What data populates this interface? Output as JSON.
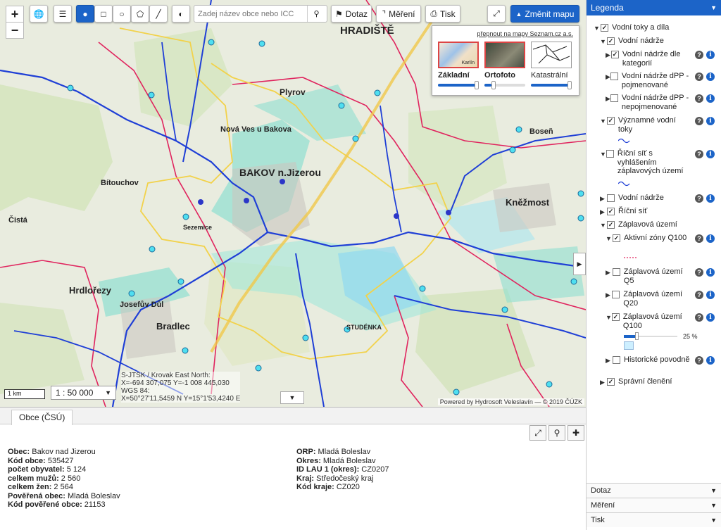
{
  "toolbar": {
    "zoom_in": "+",
    "zoom_out": "−",
    "search_placeholder": "Zadej název obce nebo ICC",
    "dotaz_label": "Dotaz",
    "mereni_label": "Měření",
    "tisk_label": "Tisk",
    "zmenit_mapu_label": "Změnit mapu"
  },
  "map_switcher": {
    "link": "přepnout na mapy Seznam.cz a.s.",
    "maps": [
      {
        "label": "Základní"
      },
      {
        "label": "Ortofoto"
      },
      {
        "label": "Katastrální"
      }
    ],
    "tile_text": "Karlín"
  },
  "map": {
    "labels": [
      {
        "text": "HRADIŠTĚ"
      },
      {
        "text": "BAKOV n.Jizerou"
      },
      {
        "text": "Kněžmost"
      },
      {
        "text": "Hrdlořezy"
      },
      {
        "text": "Bradlec"
      },
      {
        "text": "Plyrov"
      },
      {
        "text": "Nová Ves u Bakova"
      },
      {
        "text": "Bítouchov"
      },
      {
        "text": "Čistá"
      },
      {
        "text": "Josefův Důl"
      },
      {
        "text": "STUDÉNKA"
      },
      {
        "text": "Boseň"
      },
      {
        "text": "Sezemice"
      }
    ],
    "scale": "1 : 50 000",
    "scalebar": "1 km",
    "coords": [
      "S-JTSK / Krovak East North:",
      "X=-694 307,075 Y=-1 008 445,030",
      "WGS 84:",
      "X=50°27'11,5459 N Y=15°1'53,4240 E"
    ],
    "attribution": "Powered by Hydrosoft Veleslavín — © 2019 ČÚZK"
  },
  "bottom_panel": {
    "tab": "Obce (ČSÚ)",
    "left": [
      {
        "k": "Obec:",
        "v": " Bakov nad Jizerou"
      },
      {
        "k": "Kód obce:",
        "v": " 535427"
      },
      {
        "k": "počet obyvatel:",
        "v": " 5 124"
      },
      {
        "k": "celkem mužů:",
        "v": " 2 560"
      },
      {
        "k": "celkem žen:",
        "v": " 2 564"
      },
      {
        "k": "Pověřená obec:",
        "v": " Mladá Boleslav"
      },
      {
        "k": "Kód pověřené obce:",
        "v": " 21153"
      }
    ],
    "right": [
      {
        "k": "ORP:",
        "v": " Mladá Boleslav"
      },
      {
        "k": "Okres:",
        "v": " Mladá Boleslav"
      },
      {
        "k": "ID LAU 1 (okres):",
        "v": " CZ0207"
      },
      {
        "k": "Kraj:",
        "v": " Středočeský kraj"
      },
      {
        "k": "Kód kraje:",
        "v": " CZ020"
      }
    ]
  },
  "legend": {
    "title": "Legenda",
    "items": [
      {
        "label": "Vodní toky a díla"
      },
      {
        "label": "Vodní nádrže"
      },
      {
        "label": "Vodní nádrže dle kategorií"
      },
      {
        "label": "Vodní nádrže dPP - pojmenované"
      },
      {
        "label": "Vodní nádrže dPP - nepojmenované"
      },
      {
        "label": "Významné vodní toky"
      },
      {
        "label": "Říční síť s vyhlášením záplavových území"
      },
      {
        "label": "Vodní nádrže"
      },
      {
        "label": "Říční síť"
      },
      {
        "label": "Záplavová území"
      },
      {
        "label": "Aktivní zóny Q100"
      },
      {
        "label": "Záplavová území Q5"
      },
      {
        "label": "Záplavová území Q20"
      },
      {
        "label": "Záplavová území Q100"
      },
      {
        "label": "Historické povodně"
      },
      {
        "label": "Správní členění"
      }
    ],
    "opacity": "25 %",
    "opacity_value": 25,
    "accordions": [
      {
        "label": "Dotaz"
      },
      {
        "label": "Měření"
      },
      {
        "label": "Tisk"
      }
    ]
  },
  "colors": {
    "accent": "#1c64c8",
    "river": "#1f3fd6",
    "flood": "#5fd6c8",
    "boundary": "#e0245e"
  }
}
